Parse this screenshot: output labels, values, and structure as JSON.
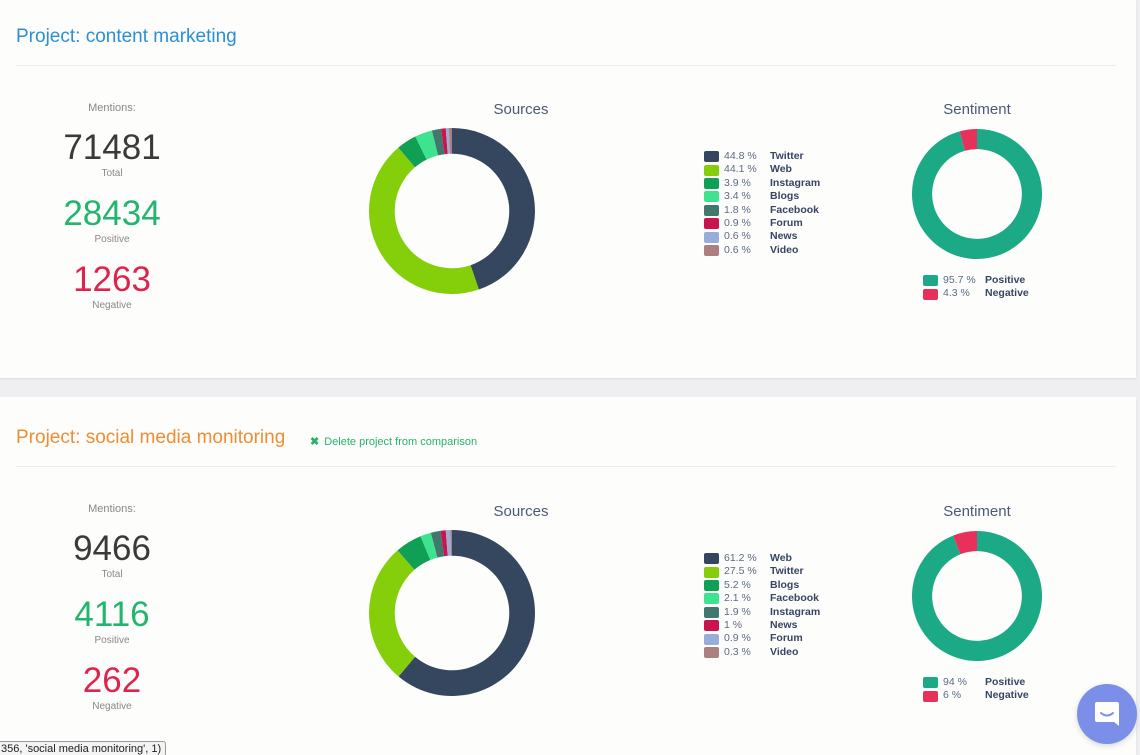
{
  "colors": {
    "source_palette": [
      "#35475f",
      "#84cf0a",
      "#0f9f55",
      "#3de38e",
      "#42776e",
      "#c8154e",
      "#98aed8",
      "#ac7f80"
    ],
    "positive": "#1ca985",
    "negative": "#e8315a"
  },
  "projects": [
    {
      "title": "Project: content marketing",
      "delete_label": null,
      "mentions_label": "Mentions:",
      "total": "71481",
      "total_label": "Total",
      "positive": "28434",
      "positive_label": "Positive",
      "negative": "1263",
      "negative_label": "Negative",
      "sources_title": "Sources",
      "sentiment_title": "Sentiment"
    },
    {
      "title": "Project: social media monitoring",
      "delete_label": "Delete project from comparison",
      "mentions_label": "Mentions:",
      "total": "9466",
      "total_label": "Total",
      "positive": "4116",
      "positive_label": "Positive",
      "negative": "262",
      "negative_label": "Negative",
      "sources_title": "Sources",
      "sentiment_title": "Sentiment"
    }
  ],
  "chart_data": [
    {
      "type": "pie",
      "variant": "donut",
      "title": "Sources",
      "project": "content marketing",
      "categories": [
        "Twitter",
        "Web",
        "Instagram",
        "Blogs",
        "Facebook",
        "Forum",
        "News",
        "Video"
      ],
      "values": [
        44.8,
        44.1,
        3.9,
        3.4,
        1.8,
        0.9,
        0.6,
        0.6
      ],
      "labels": [
        "44.8 %",
        "44.1 %",
        "3.9 %",
        "3.4 %",
        "1.8 %",
        "0.9 %",
        "0.6 %",
        "0.6 %"
      ],
      "legend": "right"
    },
    {
      "type": "pie",
      "variant": "donut",
      "title": "Sentiment",
      "project": "content marketing",
      "categories": [
        "Positive",
        "Negative"
      ],
      "values": [
        95.7,
        4.3
      ],
      "labels": [
        "95.7 %",
        "4.3 %"
      ],
      "legend": "bottom"
    },
    {
      "type": "pie",
      "variant": "donut",
      "title": "Sources",
      "project": "social media monitoring",
      "categories": [
        "Web",
        "Twitter",
        "Blogs",
        "Facebook",
        "Instagram",
        "News",
        "Forum",
        "Video"
      ],
      "values": [
        61.2,
        27.5,
        5.2,
        2.1,
        1.9,
        1,
        0.9,
        0.3
      ],
      "labels": [
        "61.2 %",
        "27.5 %",
        "5.2 %",
        "2.1 %",
        "1.9 %",
        "1 %",
        "0.9 %",
        "0.3 %"
      ],
      "legend": "right"
    },
    {
      "type": "pie",
      "variant": "donut",
      "title": "Sentiment",
      "project": "social media monitoring",
      "categories": [
        "Positive",
        "Negative"
      ],
      "values": [
        94,
        6
      ],
      "labels": [
        "94 %",
        "6 %"
      ],
      "legend": "bottom"
    }
  ],
  "tooltip": "356, 'social media monitoring', 1)",
  "chat_button_label": "chat"
}
